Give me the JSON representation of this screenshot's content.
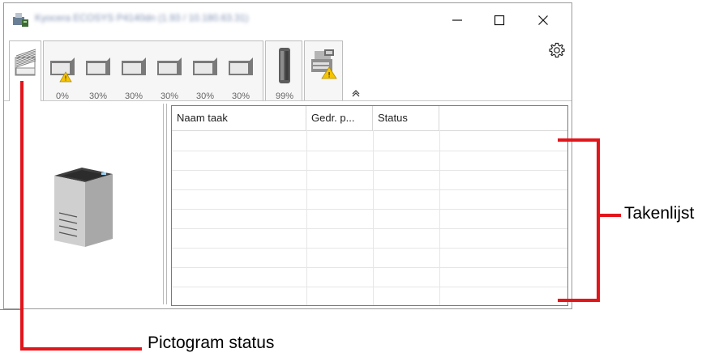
{
  "window": {
    "title": "Kyocera ECOSYS P4140dn (1.93 / 10.180.63.31)",
    "controls": {
      "minimize": "—",
      "maximize": "☐",
      "close": "✕"
    }
  },
  "tabs": {
    "trays": [
      {
        "level": "0%",
        "warning": true
      },
      {
        "level": "30%",
        "warning": false
      },
      {
        "level": "30%",
        "warning": false
      },
      {
        "level": "30%",
        "warning": false
      },
      {
        "level": "30%",
        "warning": false
      },
      {
        "level": "30%",
        "warning": false
      }
    ],
    "toner": {
      "level": "99%"
    },
    "collapse_icon": "double-chevron-up-icon",
    "settings_icon": "gear-icon"
  },
  "task_list": {
    "columns": [
      "Naam taak",
      "Gedr. p...",
      "Status",
      ""
    ],
    "rows": []
  },
  "annotations": {
    "task_list_label": "Takenlijst",
    "icon_status_label": "Pictogram status",
    "color": "#e2151b"
  }
}
